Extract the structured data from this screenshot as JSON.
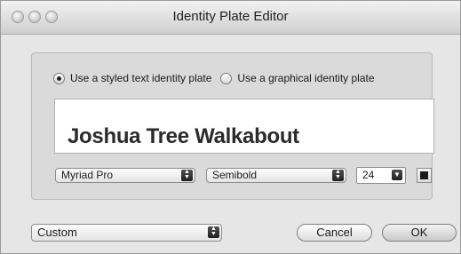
{
  "window": {
    "title": "Identity Plate Editor"
  },
  "options": {
    "styled_label": "Use a styled text identity plate",
    "graphical_label": "Use a graphical identity plate",
    "selected": "styled"
  },
  "preview": {
    "text": "Joshua Tree Walkabout"
  },
  "font": {
    "family": "Myriad Pro",
    "style": "Semibold",
    "size": "24",
    "color": "#1a1a1a"
  },
  "footer": {
    "preset": "Custom",
    "cancel_label": "Cancel",
    "ok_label": "OK"
  }
}
